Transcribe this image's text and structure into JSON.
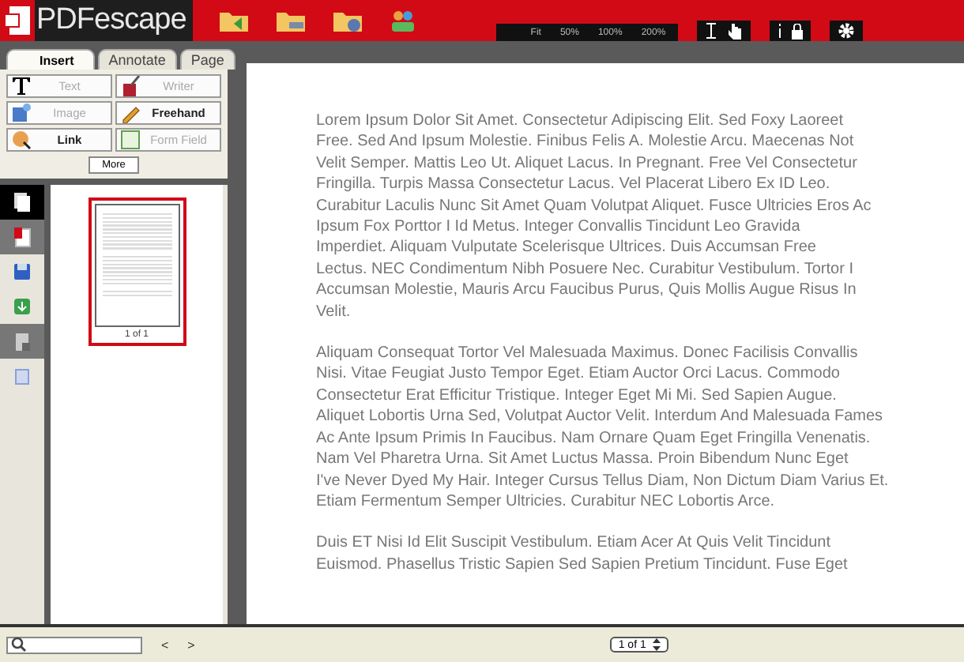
{
  "app": {
    "logo": "PDFescape"
  },
  "zoom": {
    "options": [
      {
        "label": "Fit",
        "selected": false
      },
      {
        "label": "50%",
        "selected": false
      },
      {
        "label": "100%",
        "selected": false
      },
      {
        "label": "200%",
        "selected": false
      }
    ]
  },
  "tabs": [
    {
      "label": "Insert",
      "selected": true
    },
    {
      "label": "Annotate",
      "selected": false
    },
    {
      "label": "Page",
      "selected": false
    }
  ],
  "tools": [
    {
      "label": "Text",
      "disabled": true
    },
    {
      "label": "Writer",
      "disabled": true
    },
    {
      "label": "Image",
      "disabled": true
    },
    {
      "label": "Freehand",
      "disabled": false
    },
    {
      "label": "Link",
      "disabled": false
    },
    {
      "label": "Form Field",
      "disabled": true
    }
  ],
  "more_button": "More",
  "side_icons": [
    {
      "selected": true
    },
    {
      "selected": false
    },
    {
      "selected": false
    },
    {
      "selected": false
    },
    {
      "selected": false
    },
    {
      "selected": false
    }
  ],
  "thumbnail": {
    "caption": "1 of 1"
  },
  "document": {
    "paragraphs": [
      [
        "Lorem Ipsum Dolor Sit Amet. Consectetur Adipiscing Elit. Sed Foxy Laoreet",
        "Free. Sed And Ipsum Molestie. Finibus Felis A. Molestie Arcu. Maecenas Not",
        "Velit Semper. Mattis Leo Ut. Aliquet Lacus. In Pregnant. Free Vel Consectetur",
        "Fringilla. Turpis Massa Consectetur Lacus. Vel Placerat Libero Ex ID Leo.",
        "Curabitur Laculis Nunc Sit Amet Quam Volutpat Aliquet. Fusce Ultricies Eros Ac",
        "Ipsum Fox Porttor I Id Metus. Integer Convallis Tincidunt Leo Gravida",
        "Imperdiet. Aliquam Vulputate Scelerisque Ultrices. Duis Accumsan Free",
        "Lectus. NEC Condimentum Nibh Posuere Nec. Curabitur Vestibulum. Tortor I",
        "Accumsan Molestie, Mauris Arcu Faucibus Purus, Quis Mollis Augue Risus In",
        "Velit."
      ],
      [
        "Aliquam Consequat Tortor Vel Malesuada Maximus. Donec Facilisis Convallis",
        "Nisi. Vitae Feugiat Justo Tempor Eget. Etiam Auctor Orci Lacus. Commodo",
        "Consectetur Erat Efficitur Tristique. Integer Eget Mi Mi. Sed Sapien Augue.",
        "Aliquet Lobortis Urna Sed, Volutpat Auctor Velit. Interdum And Malesuada Fames",
        "Ac Ante Ipsum Primis In Faucibus. Nam Ornare Quam Eget Fringilla Venenatis.",
        "Nam Vel Pharetra Urna. Sit Amet Luctus Massa. Proin Bibendum Nunc Eget",
        "I've Never Dyed My Hair. Integer Cursus Tellus Diam, Non Dictum Diam Varius Et.",
        "Etiam Fermentum Semper Ultricies. Curabitur NEC Lobortis Arce."
      ],
      [
        "Duis ET Nisi Id Elit Suscipit Vestibulum. Etiam Acer At Quis Velit Tincidunt",
        "Euismod. Phasellus Tristic Sapien Sed Sapien Pretium Tincidunt. Fuse Eget"
      ]
    ]
  },
  "bottom": {
    "prev": "<",
    "next": ">",
    "page_select": "1 of 1"
  }
}
